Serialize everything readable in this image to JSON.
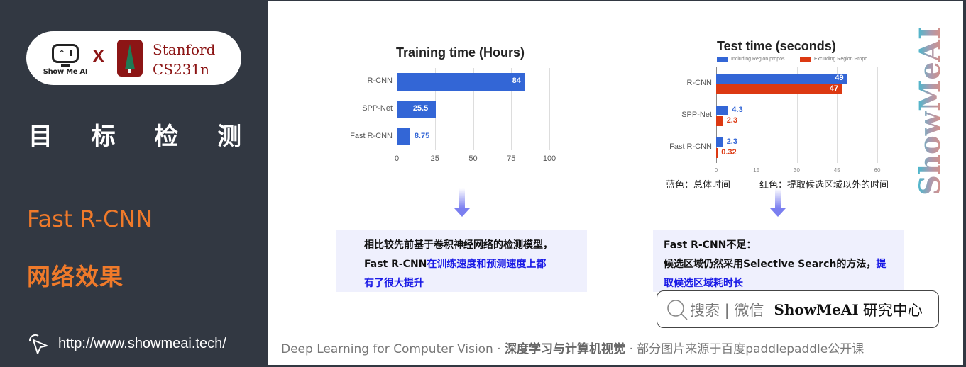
{
  "sidebar": {
    "logo": {
      "brand": "Show Me AI",
      "cross": "X",
      "partner_line1": "Stanford",
      "partner_line2": "CS231n"
    },
    "topic_chars": [
      "目",
      "标",
      "检",
      "测"
    ],
    "section": "Fast R-CNN",
    "subsection": "网络效果",
    "url": "http://www.showmeai.tech/",
    "url_icon": "cursor-click-icon"
  },
  "chart_data": [
    {
      "type": "bar",
      "orientation": "horizontal",
      "title": "Training time (Hours)",
      "categories": [
        "R-CNN",
        "SPP-Net",
        "Fast R-CNN"
      ],
      "series": [
        {
          "name": "Training time",
          "values": [
            84,
            25.5,
            8.75
          ],
          "color": "#3366d6"
        }
      ],
      "data_labels": [
        "84",
        "25.5",
        "8.75"
      ],
      "xlim": [
        0,
        100
      ],
      "xticks": [
        0,
        25,
        50,
        75,
        100
      ],
      "grid": true,
      "legend": "none"
    },
    {
      "type": "bar",
      "orientation": "horizontal",
      "title": "Test time (seconds)",
      "categories": [
        "R-CNN",
        "SPP-Net",
        "Fast R-CNN"
      ],
      "series": [
        {
          "name": "Including Region propos...",
          "values": [
            49,
            4.3,
            2.3
          ],
          "color": "#3366d6",
          "labels": [
            "49",
            "4.3",
            "2.3"
          ]
        },
        {
          "name": "Excluding Region Propo...",
          "values": [
            47,
            2.3,
            0.32
          ],
          "color": "#dc3912",
          "labels": [
            "47",
            "2.3",
            "0.32"
          ]
        }
      ],
      "xlim": [
        0,
        60
      ],
      "xticks": [
        0,
        15,
        30,
        45,
        60
      ],
      "grid": true,
      "legend": "top"
    }
  ],
  "notes": {
    "blue": "蓝色：总体时间",
    "red": "红色：提取候选区域以外的时间"
  },
  "callout_left": {
    "line1": "相比较先前基于卷积神经网络的检测模型，",
    "line2_plain": "Fast R-CNN",
    "line2_hl": "在训练速度和预测速度上都",
    "line3_hl": "有了很大提升"
  },
  "callout_right": {
    "line1": "Fast R-CNN不足：",
    "line2_plain": "候选区域仍然采用Selective Search的方法，",
    "line2_hl": "提",
    "line3_hl": "取候选区域耗时长"
  },
  "watermark": "ShowMeAI",
  "search": {
    "icon": "search-icon",
    "hint": "搜索 | 微信",
    "brand": "ShowMeAI",
    "brand_suffix": "研究中心"
  },
  "footer": {
    "en": "Deep Learning for Computer Vision",
    "sep": " · ",
    "cn": "深度学习与计算机视觉",
    "source": "部分图片来源于百度paddlepaddle公开课"
  },
  "colors": {
    "sidebar_bg": "#323842",
    "accent_orange": "#f07a2a",
    "bar_blue": "#3366d6",
    "bar_red": "#dc3912",
    "highlight_blue": "#1a1ae6",
    "callout_bg": "#eff0fd"
  }
}
